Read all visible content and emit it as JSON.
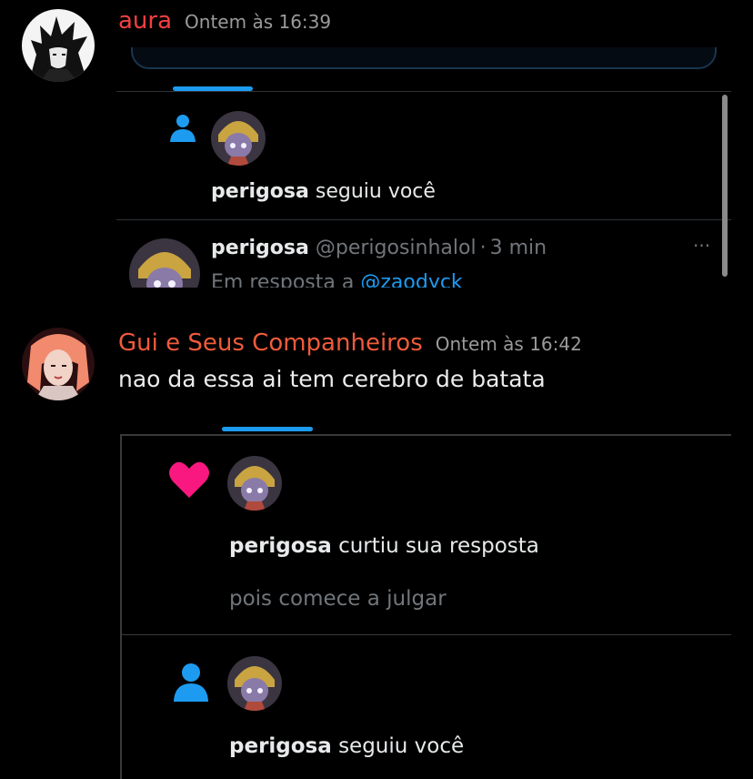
{
  "messages": [
    {
      "author": "aura",
      "author_color": "#f23f42",
      "timestamp": "Ontem às 16:39",
      "embed": {
        "notification": {
          "username": "perigosa",
          "action": "seguiu você"
        },
        "tweet": {
          "name": "perigosa",
          "handle": "@perigosinhalol",
          "separator": "·",
          "time": "3 min",
          "reply_prefix": "Em resposta a",
          "reply_to": "@zaodyck",
          "more": "···"
        }
      }
    },
    {
      "author": "Gui e Seus Companheiros",
      "author_color": "#f05a3c",
      "timestamp": "Ontem às 16:42",
      "text": "nao da essa ai tem cerebro de batata",
      "embed": {
        "like_notification": {
          "username": "perigosa",
          "action": "curtiu sua resposta",
          "quoted": "pois comece a julgar"
        },
        "follow_notification": {
          "username": "perigosa",
          "action": "seguiu você"
        }
      }
    }
  ],
  "colors": {
    "twitter_blue": "#1d9bf0",
    "heart_pink": "#f91880",
    "background": "#000000"
  }
}
